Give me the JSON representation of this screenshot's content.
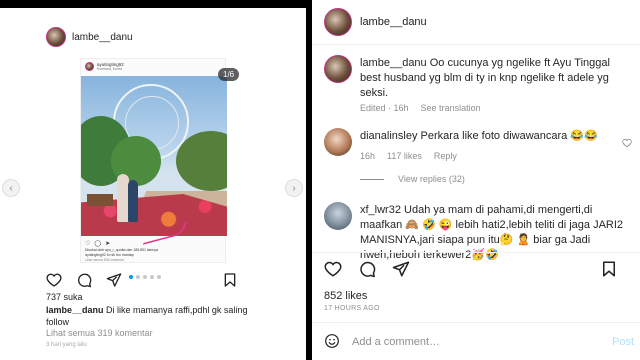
{
  "left_post": {
    "username": "lambe__danu",
    "inner": {
      "username": "ayutingting92",
      "location": "Everland, Korea",
      "liked_by": "Disukai oleh ayu_r_quotta dan 185.851 lainnya",
      "caption": "ayutingting92 lo nih trio mantap",
      "view_all": "Lihat semua 833 komentar"
    },
    "counter": "1/6",
    "likes": "737 suka",
    "caption_user": "lambe__danu",
    "caption_text": "Di like mamanya raffi,pdhl gk saling follow",
    "view_all": "Lihat semua 319 komentar",
    "timestamp": "3 hari yang lalu",
    "nav_prev": "‹",
    "nav_next": "›"
  },
  "right_panel": {
    "username": "lambe__danu",
    "caption_user": "lambe__danu",
    "caption_text": "Oo cucunya yg ngelike ft Ayu Tinggal best husband yg blm di ty in knp ngelike ft adele yg seksi.",
    "caption_meta": {
      "edited": "Edited · 16h",
      "see_translation": "See translation"
    },
    "comments": [
      {
        "user": "dianalinsley",
        "text": "Perkara like foto diwawancara 😂😂",
        "time": "16h",
        "likes": "117 likes",
        "reply": "Reply",
        "view_replies": "View replies (32)"
      },
      {
        "user": "xf_lwr32",
        "text": "Udah ya mam di pahami,di mengerti,di maafkan 🙈 🤣 😜 lebih hati2,lebih teliti di jaga JARI2 MANISNYA,jari siapa pun itu🤔 🙎 biar ga Jadi riweh,heboh terkewer2🥳🤣"
      }
    ],
    "likes": "852 likes",
    "date": "17 HOURS AGO",
    "add_comment_placeholder": "Add a comment…",
    "post_label": "Post"
  },
  "colors": {
    "accent_blue": "#0095f6",
    "ring": "#c13584",
    "muted": "#8e8e8e"
  },
  "icons": [
    "heart-icon",
    "comment-icon",
    "share-icon",
    "bookmark-icon",
    "emoji-icon",
    "chevron-left-icon",
    "chevron-right-icon"
  ]
}
